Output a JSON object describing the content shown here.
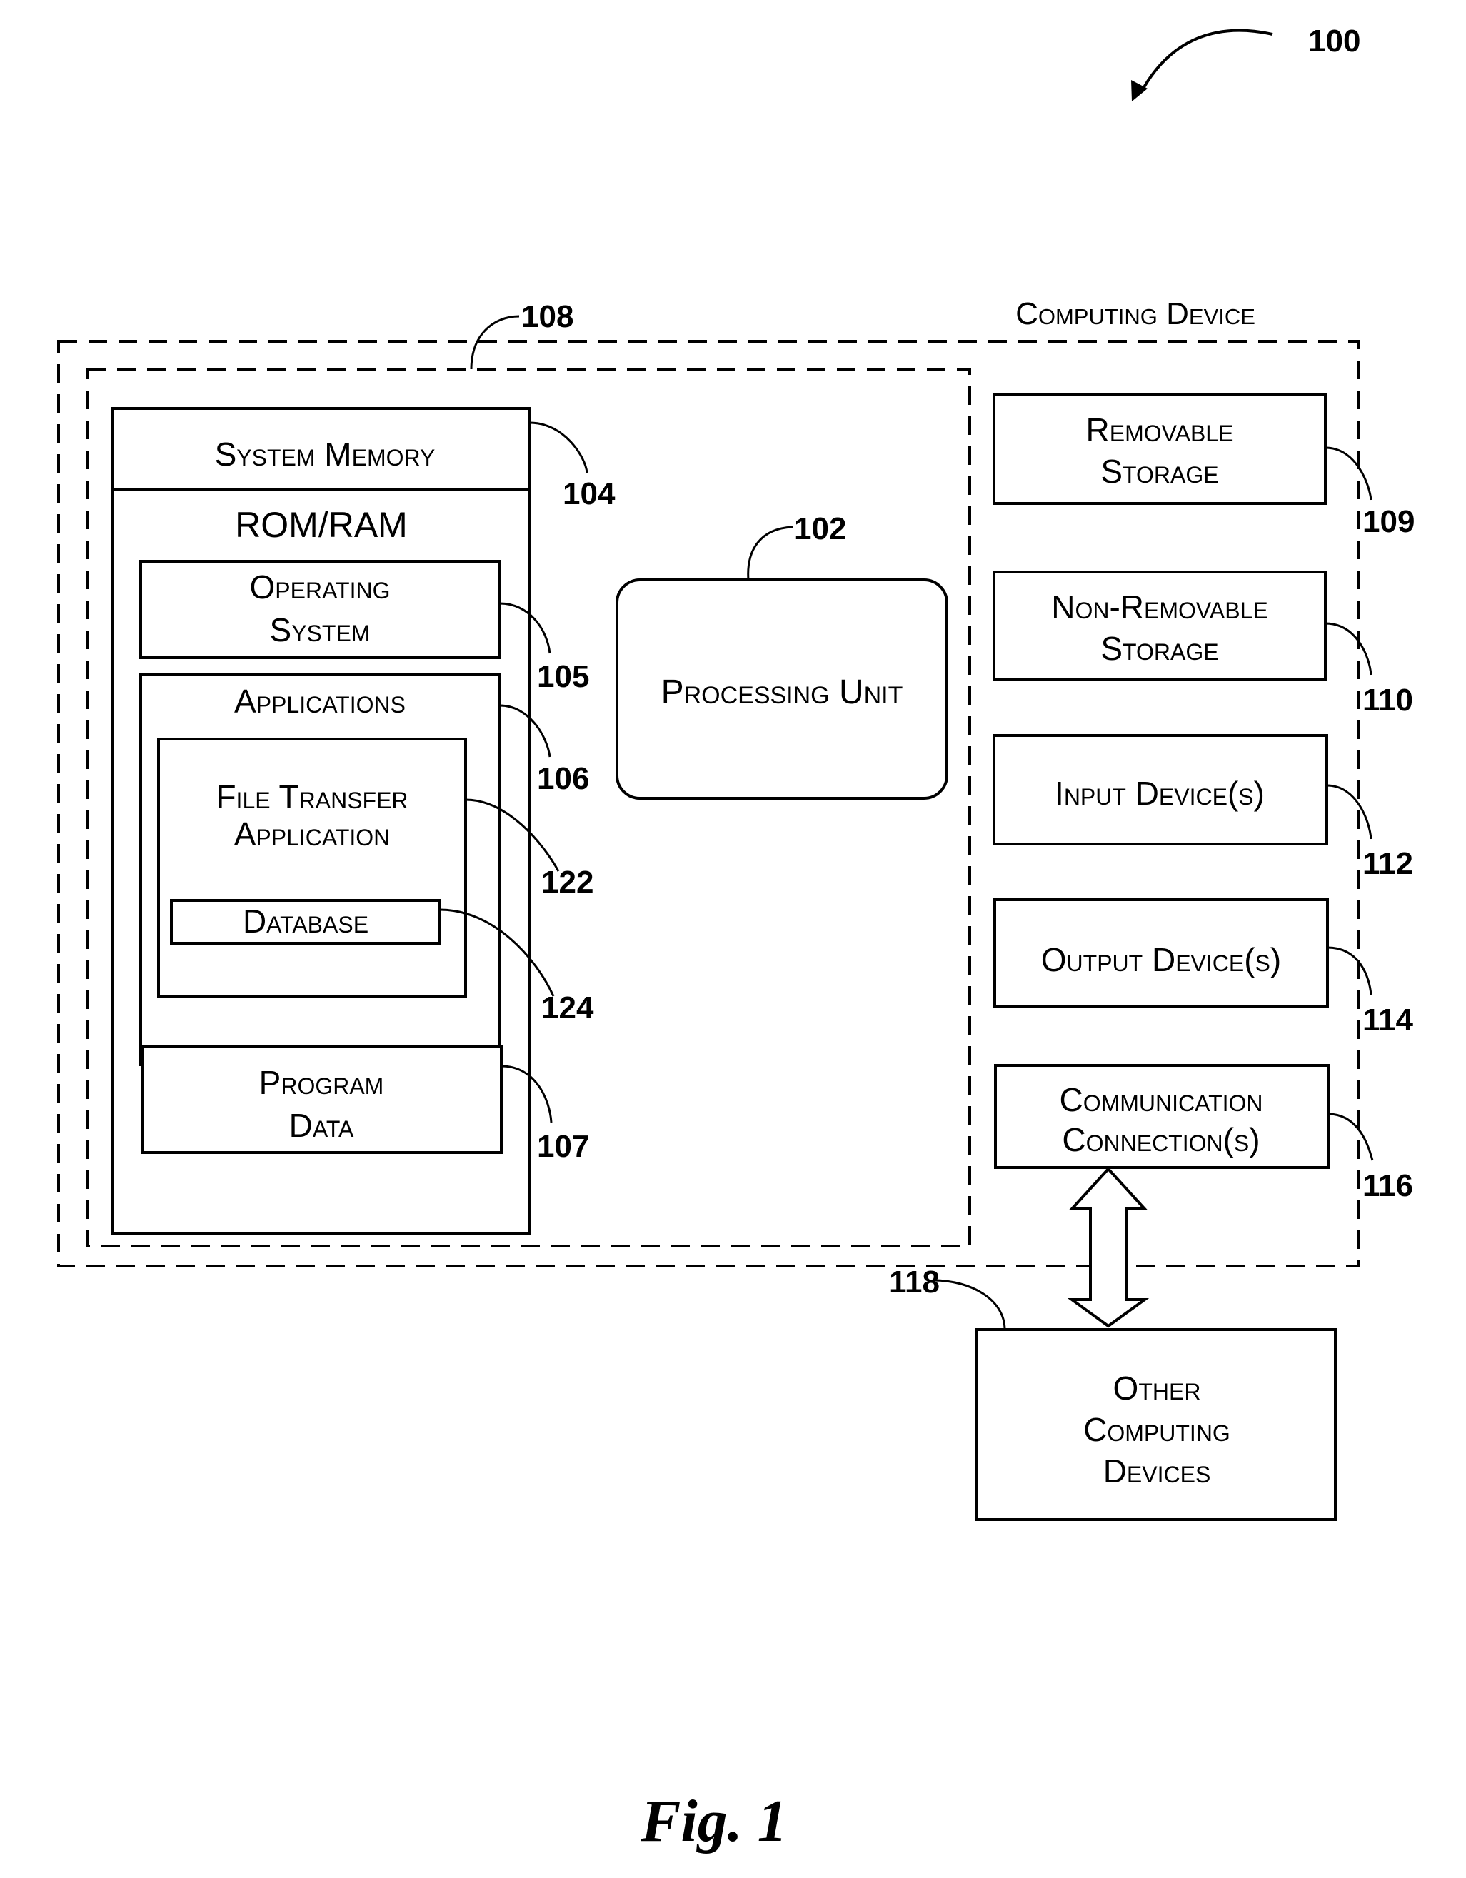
{
  "figure": {
    "caption": "Fig. 1",
    "reference": "100"
  },
  "computing_device": {
    "title": "Computing Device",
    "inner_group_ref": "108"
  },
  "system_memory": {
    "title": "System Memory",
    "ref": "104",
    "subtitle": "ROM/RAM",
    "operating_system": {
      "line1": "Operating",
      "line2": "System",
      "ref": "105"
    },
    "applications": {
      "title": "Applications",
      "ref": "106",
      "file_transfer": {
        "line1": "File Transfer",
        "line2": "Application",
        "ref": "122",
        "database": {
          "label": "Database",
          "ref": "124"
        }
      }
    },
    "program_data": {
      "line1": "Program",
      "line2": "Data",
      "ref": "107"
    }
  },
  "processing_unit": {
    "label": "Processing Unit",
    "ref": "102"
  },
  "peripherals": [
    {
      "line1": "Removable",
      "line2": "Storage",
      "ref": "109"
    },
    {
      "line1": "Non-Removable",
      "line2": "Storage",
      "ref": "110"
    },
    {
      "line1": "Input Device(s)",
      "line2": "",
      "ref": "112"
    },
    {
      "line1": "Output Device(s)",
      "line2": "",
      "ref": "114"
    },
    {
      "line1": "Communication",
      "line2": "Connection(s)",
      "ref": "116"
    }
  ],
  "other_devices": {
    "line1": "Other",
    "line2": "Computing",
    "line3": "Devices",
    "ref": "118"
  }
}
